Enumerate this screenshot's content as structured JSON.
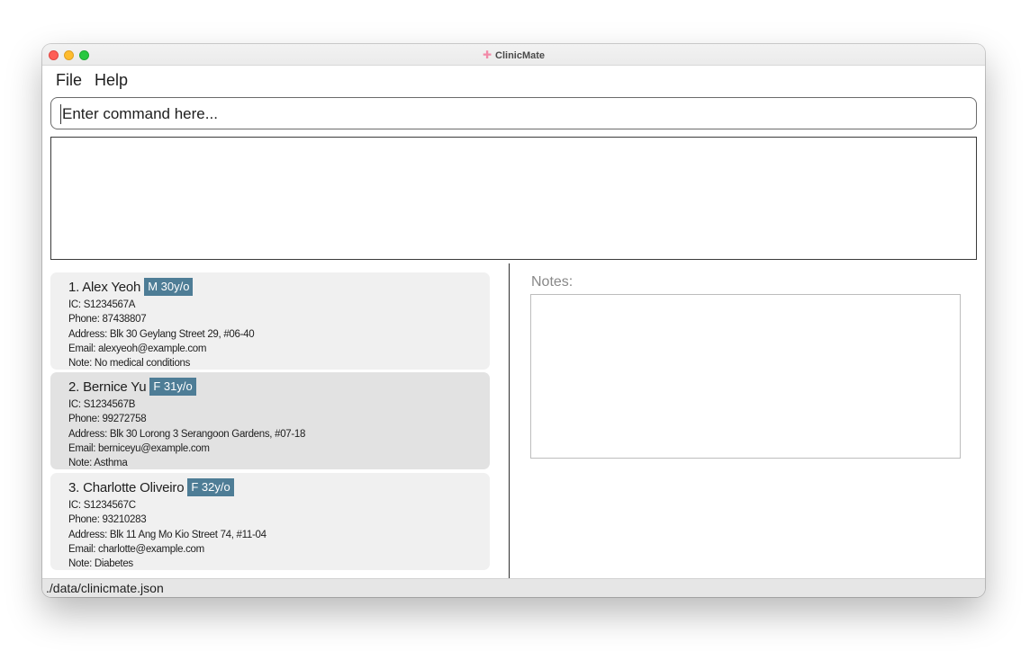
{
  "window": {
    "title": "ClinicMate",
    "title_icon": "plus-icon"
  },
  "menu": {
    "file_label": "File",
    "help_label": "Help"
  },
  "command": {
    "placeholder": "Enter command here..."
  },
  "result": {
    "text": ""
  },
  "patients": [
    {
      "index_name": "1.  Alex Yeoh",
      "badge": "M 30y/o",
      "ic": "IC: S1234567A",
      "phone": "Phone: 87438807",
      "address": "Address: Blk 30 Geylang Street 29, #06-40",
      "email": "Email: alexyeoh@example.com",
      "note": "Note: No medical conditions"
    },
    {
      "index_name": "2.  Bernice Yu",
      "badge": "F 31y/o",
      "ic": "IC: S1234567B",
      "phone": "Phone: 99272758",
      "address": "Address: Blk 30 Lorong 3 Serangoon Gardens, #07-18",
      "email": "Email: berniceyu@example.com",
      "note": "Note: Asthma"
    },
    {
      "index_name": "3.  Charlotte Oliveiro",
      "badge": "F 32y/o",
      "ic": "IC: S1234567C",
      "phone": "Phone: 93210283",
      "address": "Address: Blk 11 Ang Mo Kio Street 74, #11-04",
      "email": "Email: charlotte@example.com",
      "note": "Note: Diabetes"
    }
  ],
  "notes_panel": {
    "label": "Notes:",
    "content": ""
  },
  "status": {
    "file_path": "./data/clinicmate.json"
  },
  "colors": {
    "badge": "#4e7d96",
    "card": "#f0f0f0",
    "card_selected": "#e2e2e2"
  }
}
